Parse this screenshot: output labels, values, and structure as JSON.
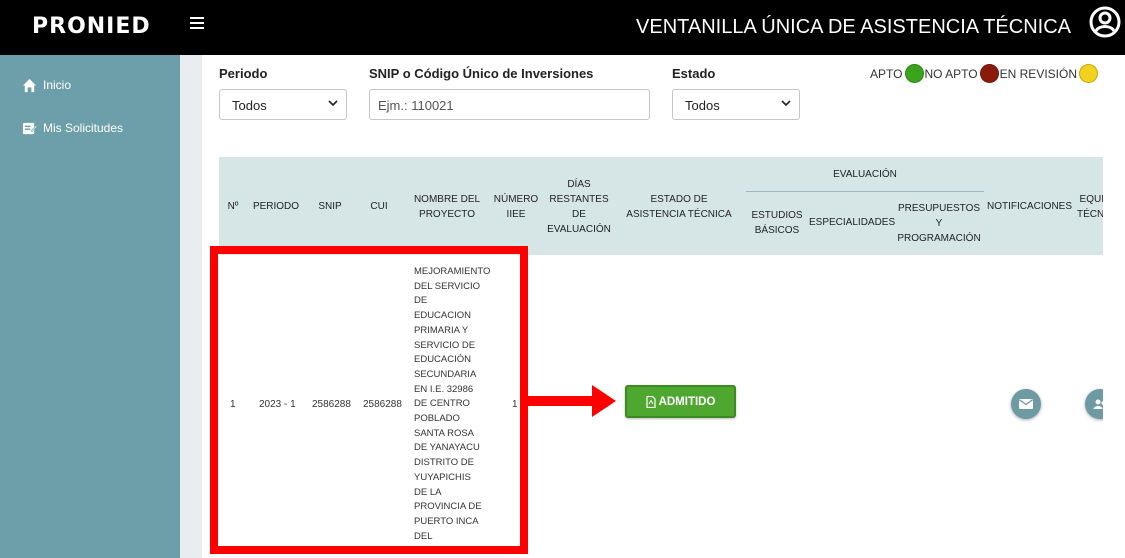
{
  "header": {
    "logo_text": "PRONIED",
    "title": "VENTANILLA ÚNICA DE ASISTENCIA TÉCNICA"
  },
  "sidebar": {
    "items": [
      {
        "label": "Inicio",
        "icon": "home-icon"
      },
      {
        "label": "Mis Solicitudes",
        "icon": "requests-icon"
      }
    ]
  },
  "filters": {
    "periodo": {
      "label": "Periodo",
      "value": "Todos"
    },
    "snip": {
      "label": "SNIP o Código Único de Inversiones",
      "placeholder": "Ejm.: 110021"
    },
    "estado": {
      "label": "Estado",
      "value": "Todos"
    }
  },
  "legend": {
    "apto": {
      "label": "APTO",
      "color": "#3aa51a"
    },
    "no_apto": {
      "label": "NO APTO",
      "color": "#8b1a0c"
    },
    "en_revision": {
      "label": "EN REVISIÓN",
      "color": "#f2d21c"
    }
  },
  "table": {
    "headers": {
      "n": "Nº",
      "periodo": "PERIODO",
      "snip": "SNIP",
      "cui": "CUI",
      "nombre": "NOMBRE DEL PROYECTO",
      "numero_iiee": "NÚMERO IIEE",
      "dias": "DÍAS RESTANTES DE EVALUACIÓN",
      "estado": "ESTADO DE ASISTENCIA TÉCNICA",
      "evaluacion": "EVALUACIÓN",
      "estudios": "ESTUDIOS BÁSICOS",
      "especialidades": "ESPECIALIDADES",
      "presupuestos": "PRESUPUESTOS Y PROGRAMACIÓN",
      "notificaciones": "NOTIFICACIONES",
      "equipo": "EQUIPO TÉCNICO"
    },
    "rows": [
      {
        "n": "1",
        "periodo": "2023 - 1",
        "snip": "2586288",
        "cui": "2586288",
        "nombre": "MEJORAMIENTO DEL SERVICIO DE EDUCACION PRIMARIA Y SERVICIO DE EDUCACIÓN SECUNDARIA EN I.E. 32986 DE CENTRO POBLADO SANTA ROSA DE YANAYACU DISTRITO DE YUYAPICHIS DE LA PROVINCIA DE PUERTO INCA DEL DEPARTAMENTO DE HUANUCO",
        "numero_iiee": "1",
        "estado_label": "ADMITIDO"
      }
    ]
  },
  "colors": {
    "topbar": "#000000",
    "sidebar": "#6c9faa",
    "table_header": "#d6e6e7",
    "admitido": "#4ea72e",
    "annotation": "#ff0000"
  }
}
